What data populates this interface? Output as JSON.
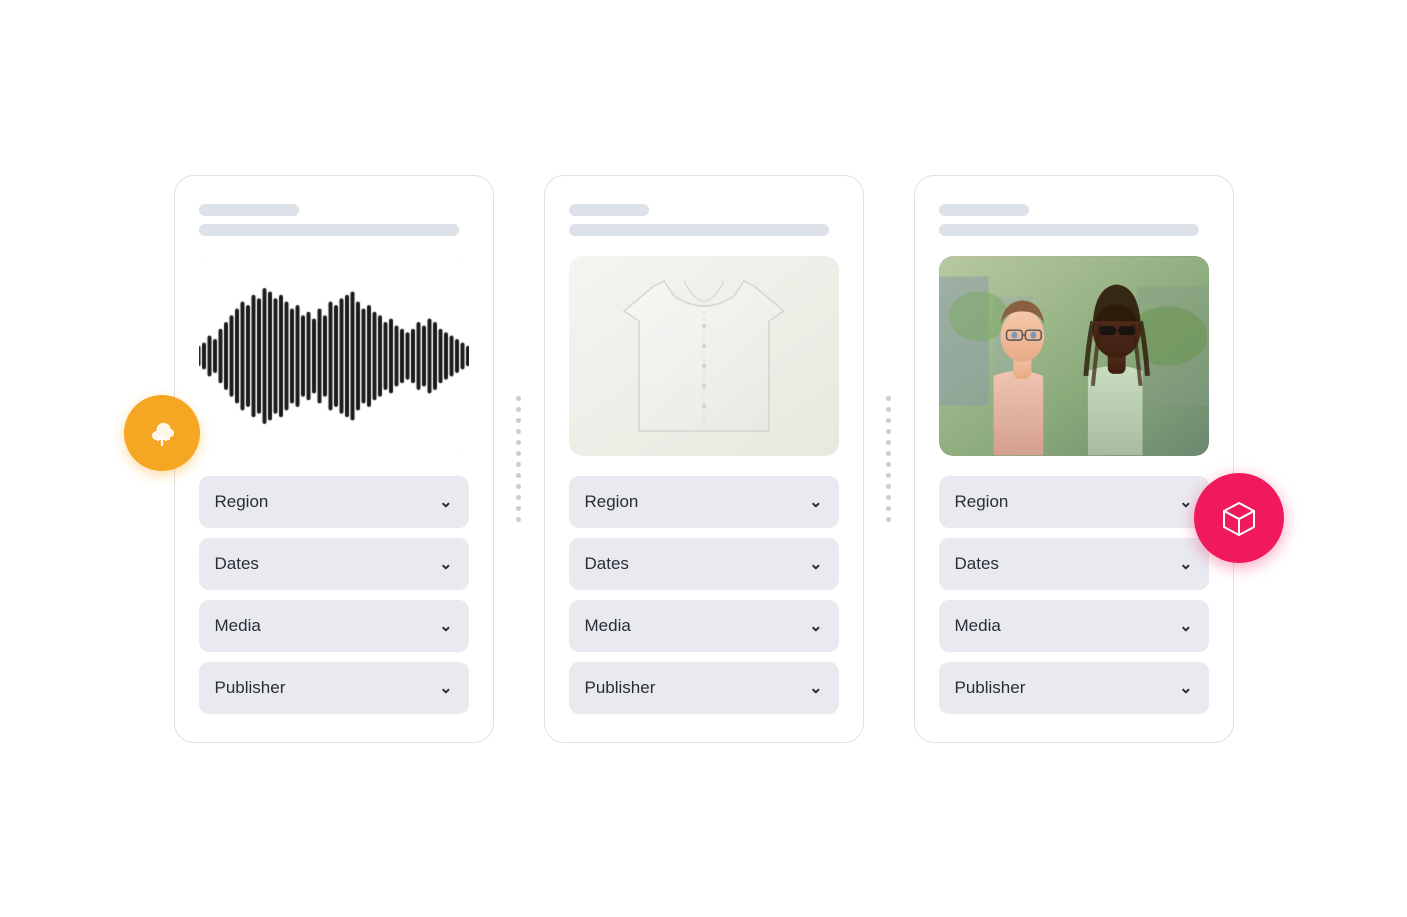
{
  "cards": [
    {
      "id": "card-audio",
      "header": {
        "line1_width": 100,
        "line2_width": 160
      },
      "media_type": "waveform",
      "filters": [
        {
          "label": "Region",
          "id": "region"
        },
        {
          "label": "Dates",
          "id": "dates"
        },
        {
          "label": "Media",
          "id": "media"
        },
        {
          "label": "Publisher",
          "id": "publisher"
        }
      ]
    },
    {
      "id": "card-shirt",
      "header": {
        "line1_width": 80,
        "line2_width": 200
      },
      "media_type": "shirt",
      "filters": [
        {
          "label": "Region",
          "id": "region"
        },
        {
          "label": "Dates",
          "id": "dates"
        },
        {
          "label": "Media",
          "id": "media"
        },
        {
          "label": "Publisher",
          "id": "publisher"
        }
      ]
    },
    {
      "id": "card-photo",
      "header": {
        "line1_width": 90,
        "line2_width": 180
      },
      "media_type": "photo",
      "filters": [
        {
          "label": "Region",
          "id": "region"
        },
        {
          "label": "Dates",
          "id": "dates"
        },
        {
          "label": "Media",
          "id": "media"
        },
        {
          "label": "Publisher",
          "id": "publisher"
        }
      ]
    }
  ],
  "icons": {
    "chevron": "❯",
    "cloud_upload": "upload",
    "box_3d": "box"
  },
  "colors": {
    "orange_badge": "#f5a623",
    "pink_badge": "#f0195c",
    "card_border": "#dde1e8",
    "skeleton": "#dde1e8",
    "filter_bg": "#e8eaf0",
    "filter_text": "#2a2d35"
  }
}
